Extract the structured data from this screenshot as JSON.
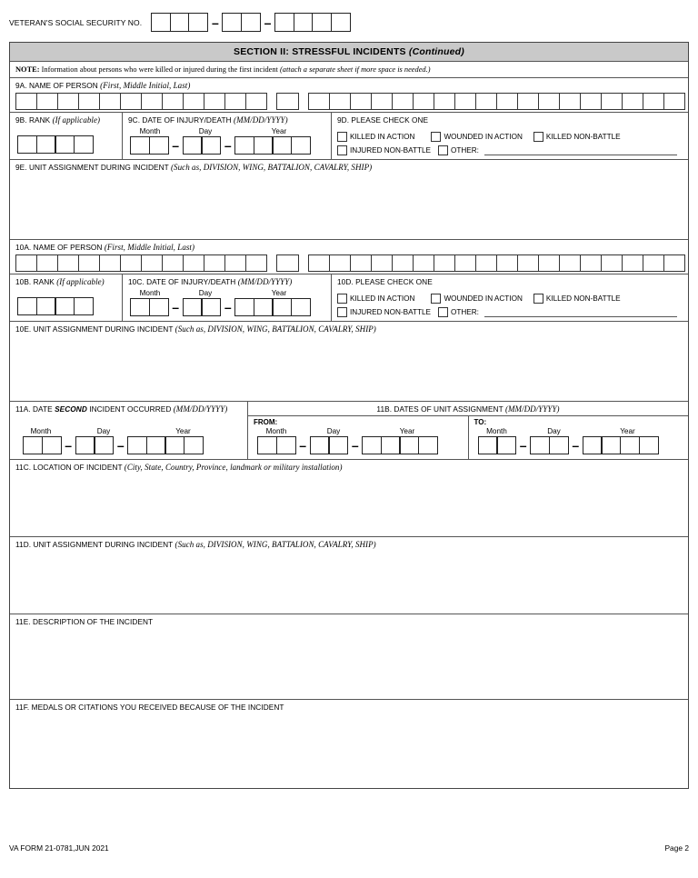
{
  "header": {
    "ssn_label": "VETERAN'S SOCIAL SECURITY NO.",
    "ssn_groups": [
      3,
      2,
      4
    ],
    "separator": "–"
  },
  "section": {
    "title": "SECTION II: STRESSFUL INCIDENTS",
    "title_suffix": "(Continued)",
    "note_prefix": "NOTE:",
    "note_text": "Information about persons who were killed or injured during the first incident",
    "note_italic": "(attach a separate sheet if more space is needed.)"
  },
  "person9": {
    "name_label": "9A. NAME OF PERSON",
    "name_hint": "(First, Middle Initial, Last)",
    "first_boxes": 12,
    "middle_boxes": 1,
    "last_boxes": 18,
    "rank_label": "9B. RANK",
    "rank_hint": "(If applicable)",
    "rank_boxes": 4,
    "date_label": "9C. DATE OF INJURY/DEATH",
    "date_hint": "(MM/DD/YYYY)",
    "month_label": "Month",
    "day_label": "Day",
    "year_label": "Year",
    "check_label": "9D. PLEASE CHECK ONE",
    "options": [
      "KILLED IN ACTION",
      "WOUNDED IN ACTION",
      "KILLED NON-BATTLE",
      "INJURED NON-BATTLE",
      "OTHER:"
    ],
    "unit_label": "9E. UNIT ASSIGNMENT DURING INCIDENT",
    "unit_hint": "(Such as, DIVISION, WING, BATTALION, CAVALRY, SHIP)"
  },
  "person10": {
    "name_label": "10A. NAME OF PERSON",
    "name_hint": "(First, Middle Initial, Last)",
    "first_boxes": 12,
    "middle_boxes": 1,
    "last_boxes": 18,
    "rank_label": "10B. RANK",
    "rank_hint": "(If applicable)",
    "rank_boxes": 4,
    "date_label": "10C. DATE OF INJURY/DEATH",
    "date_hint": "(MM/DD/YYYY)",
    "month_label": "Month",
    "day_label": "Day",
    "year_label": "Year",
    "check_label": "10D. PLEASE CHECK ONE",
    "options": [
      "KILLED IN ACTION",
      "WOUNDED IN ACTION",
      "KILLED NON-BATTLE",
      "INJURED NON-BATTLE",
      "OTHER:"
    ],
    "unit_label": "10E. UNIT ASSIGNMENT DURING INCIDENT",
    "unit_hint": "(Such as, DIVISION, WING, BATTALION, CAVALRY,  SHIP)"
  },
  "incident11": {
    "a_label_pre": "11A. DATE",
    "a_label_bold": "SECOND",
    "a_label_post": "INCIDENT OCCURRED",
    "a_hint": "(MM/DD/YYYY)",
    "b_label": "11B. DATES OF UNIT ASSIGNMENT",
    "b_hint": "(MM/DD/YYYY)",
    "from_label": "FROM:",
    "to_label": "TO:",
    "month_label": "Month",
    "day_label": "Day",
    "year_label": "Year",
    "c_label": "11C. LOCATION OF INCIDENT",
    "c_hint": "(City, State, Country, Province, landmark or military installation)",
    "d_label": "11D. UNIT ASSIGNMENT DURING INCIDENT",
    "d_hint": "(Such as, DIVISION, WING, BATTALION, CAVALRY, SHIP)",
    "e_label": "11E. DESCRIPTION OF THE INCIDENT",
    "f_label": "11F. MEDALS OR CITATIONS YOU RECEIVED BECAUSE OF THE INCIDENT"
  },
  "footer": {
    "form_id": "VA FORM 21-0781,JUN 2021",
    "page": "Page 2"
  },
  "colors": {
    "section_bar": "#c9c9c9",
    "border": "#444444",
    "box_border": "#222222"
  }
}
